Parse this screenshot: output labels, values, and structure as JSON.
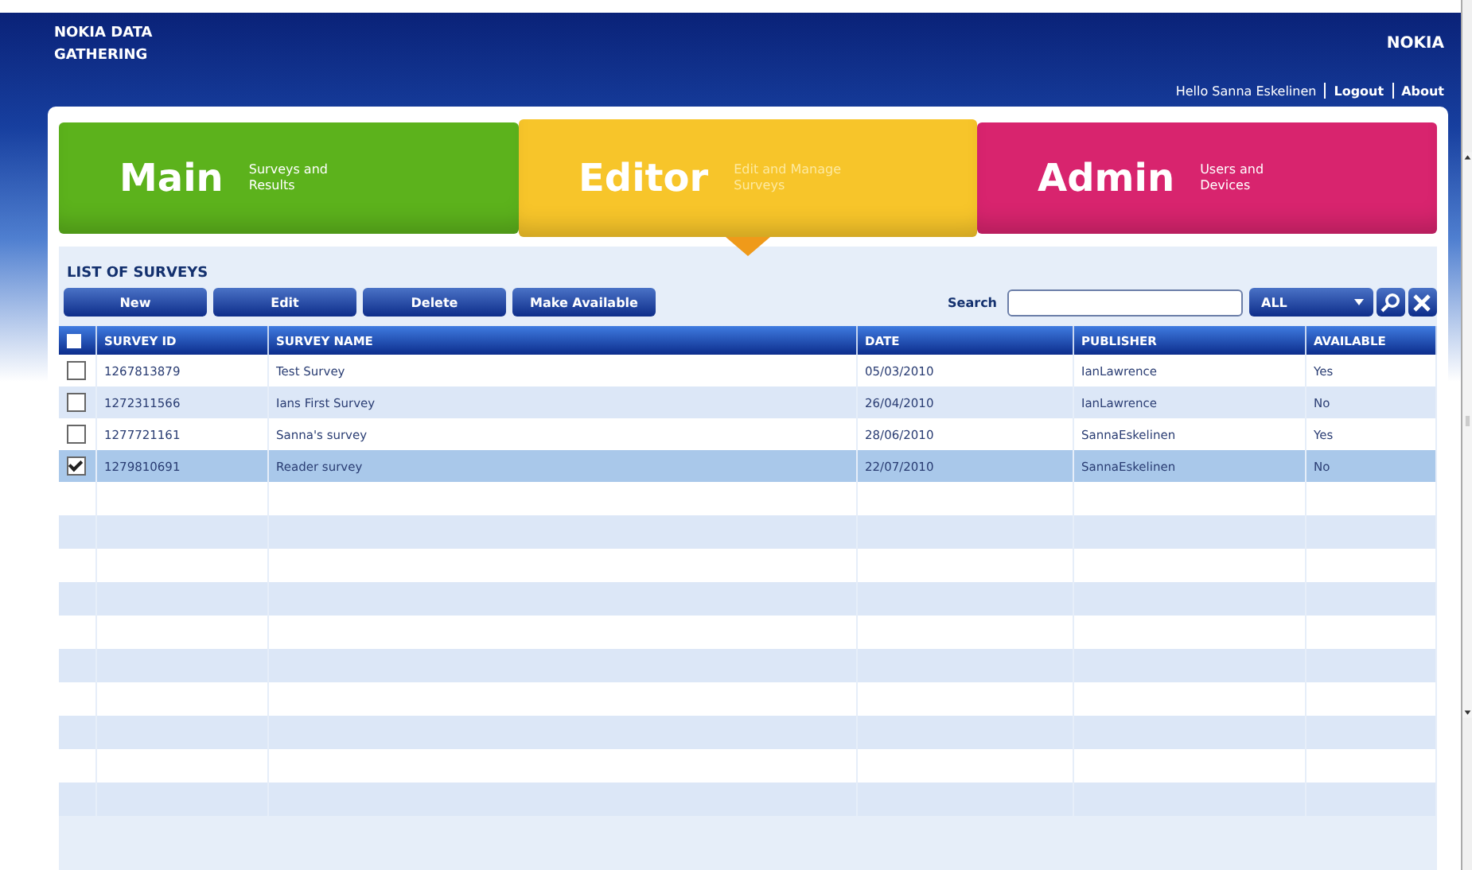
{
  "header": {
    "app_title": "NOKIA DATA GATHERING",
    "brand": "NOKIA",
    "greeting": "Hello Sanna Eskelinen",
    "links": [
      "Logout",
      "About"
    ]
  },
  "tabs": [
    {
      "title": "Main",
      "subtitle": "Surveys and Results",
      "selected": false,
      "color": "#5cb21c"
    },
    {
      "title": "Editor",
      "subtitle": "Edit and Manage Surveys",
      "selected": true,
      "color": "#f7c52a"
    },
    {
      "title": "Admin",
      "subtitle": "Users and Devices",
      "selected": false,
      "color": "#d8246e"
    }
  ],
  "list": {
    "title": "LIST OF SURVEYS",
    "buttons": [
      "New",
      "Edit",
      "Delete",
      "Make Available"
    ],
    "search": {
      "label": "Search",
      "filter": "ALL"
    },
    "columns": [
      "SURVEY ID",
      "SURVEY NAME",
      "DATE",
      "PUBLISHER",
      "AVAILABLE"
    ],
    "header_checked": false,
    "rows": [
      {
        "cells": [
          "1267813879",
          "Test Survey",
          "05/03/2010",
          "IanLawrence",
          "Yes"
        ],
        "checked": false,
        "selected": false
      },
      {
        "cells": [
          "1272311566",
          "Ians First Survey",
          "26/04/2010",
          "IanLawrence",
          "No"
        ],
        "checked": false,
        "selected": false
      },
      {
        "cells": [
          "1277721161",
          "Sanna's survey",
          "28/06/2010",
          "SannaEskelinen",
          "Yes"
        ],
        "checked": false,
        "selected": false
      },
      {
        "cells": [
          "1279810691",
          "Reader survey",
          "22/07/2010",
          "SannaEskelinen",
          "No"
        ],
        "checked": true,
        "selected": true
      }
    ]
  }
}
